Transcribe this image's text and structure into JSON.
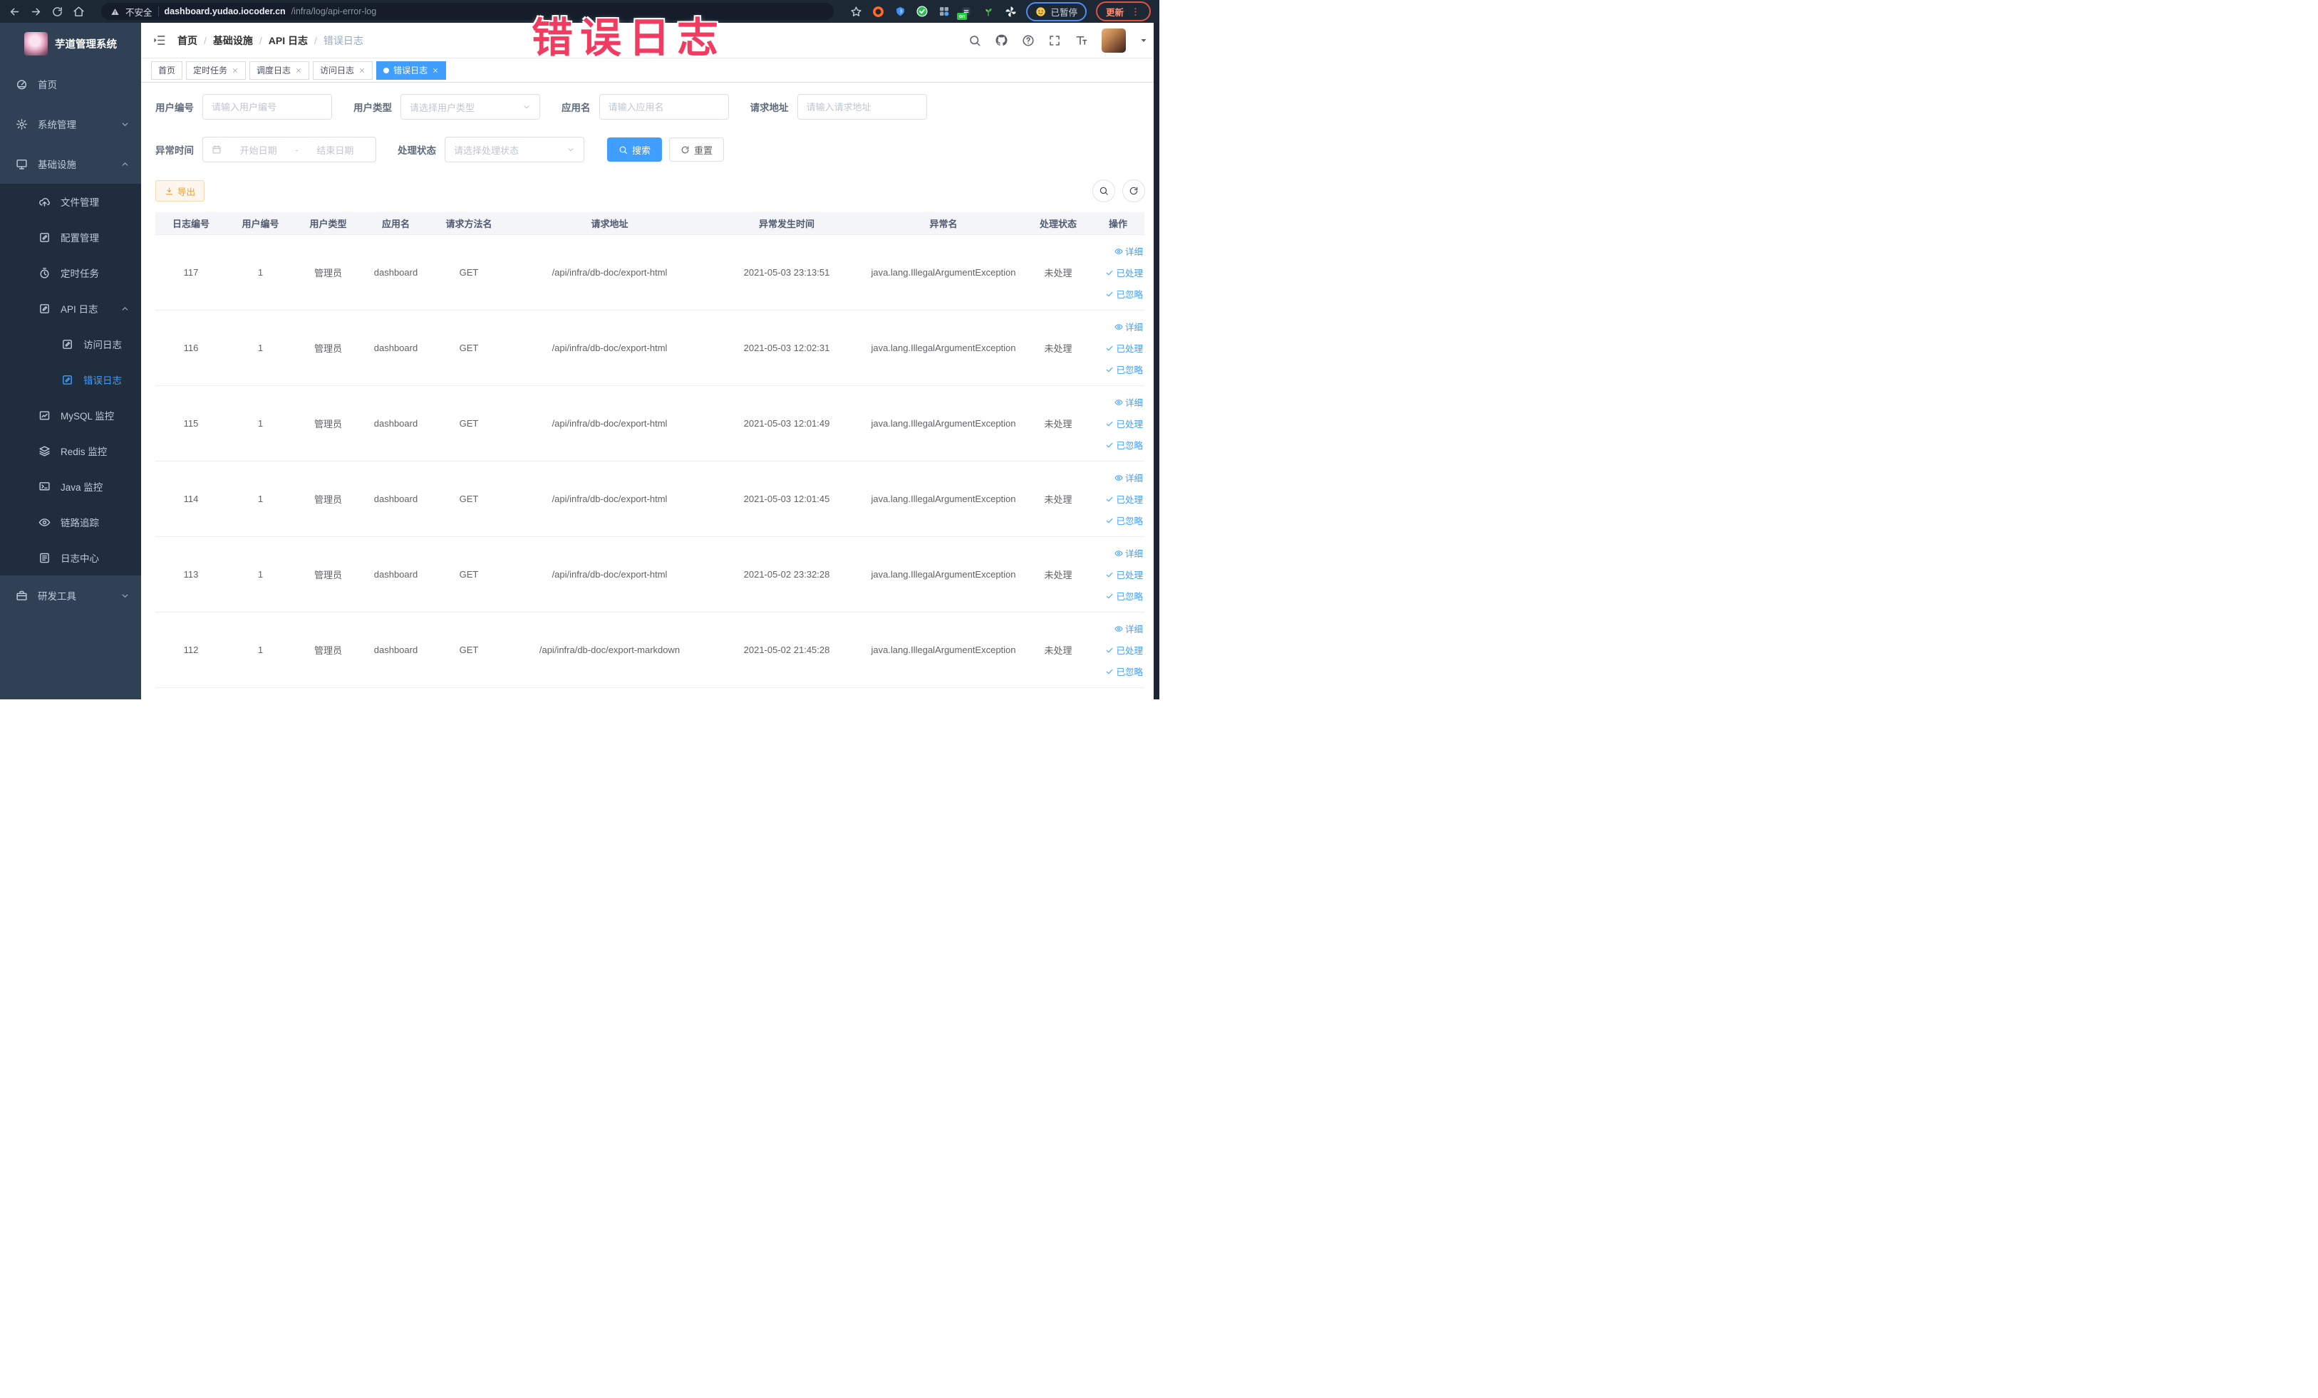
{
  "browser": {
    "security_label": "不安全",
    "url_host": "dashboard.yudao.iocoder.cn",
    "url_path": "/infra/log/api-error-log",
    "extension_badge": "on",
    "paused_label": "已暂停",
    "update_label": "更新"
  },
  "annotation": {
    "text": "错误日志",
    "color": "#f23b60"
  },
  "sidebar": {
    "title": "芋道管理系统",
    "items": [
      {
        "label": "首页",
        "icon": "dashboard-icon",
        "depth": 0
      },
      {
        "label": "系统管理",
        "icon": "gear-icon",
        "depth": 0,
        "chevron": "down"
      },
      {
        "label": "基础设施",
        "icon": "monitor-icon",
        "depth": 0,
        "chevron": "up"
      },
      {
        "label": "文件管理",
        "icon": "upload-icon",
        "depth": 1
      },
      {
        "label": "配置管理",
        "icon": "edit-icon",
        "depth": 1
      },
      {
        "label": "定时任务",
        "icon": "timer-icon",
        "depth": 1
      },
      {
        "label": "API 日志",
        "icon": "edit-icon",
        "depth": 1,
        "chevron": "up"
      },
      {
        "label": "访问日志",
        "icon": "edit-icon",
        "depth": 2
      },
      {
        "label": "错误日志",
        "icon": "edit-icon",
        "depth": 2,
        "active": true
      },
      {
        "label": "MySQL 监控",
        "icon": "chart-icon",
        "depth": 1
      },
      {
        "label": "Redis 监控",
        "icon": "layers-icon",
        "depth": 1
      },
      {
        "label": "Java 监控",
        "icon": "java-icon",
        "depth": 1
      },
      {
        "label": "链路追踪",
        "icon": "eye-icon",
        "depth": 1
      },
      {
        "label": "日志中心",
        "icon": "logcenter-icon",
        "depth": 1
      },
      {
        "label": "研发工具",
        "icon": "tool-icon",
        "depth": 0,
        "chevron": "down"
      }
    ]
  },
  "navbar": {
    "breadcrumb": [
      "首页",
      "基础设施",
      "API 日志",
      "错误日志"
    ]
  },
  "tabs": [
    {
      "label": "首页",
      "closable": false,
      "active": false
    },
    {
      "label": "定时任务",
      "closable": true,
      "active": false
    },
    {
      "label": "调度日志",
      "closable": true,
      "active": false
    },
    {
      "label": "访问日志",
      "closable": true,
      "active": false
    },
    {
      "label": "错误日志",
      "closable": true,
      "active": true
    }
  ],
  "filters": {
    "row1": [
      {
        "label": "用户编号",
        "type": "input",
        "placeholder": "请输入用户编号"
      },
      {
        "label": "用户类型",
        "type": "select",
        "placeholder": "请选择用户类型"
      },
      {
        "label": "应用名",
        "type": "input",
        "placeholder": "请输入应用名"
      },
      {
        "label": "请求地址",
        "type": "input",
        "placeholder": "请输入请求地址"
      }
    ],
    "row2": [
      {
        "label": "异常时间",
        "type": "daterange",
        "start_placeholder": "开始日期",
        "separator": "-",
        "end_placeholder": "结束日期"
      },
      {
        "label": "处理状态",
        "type": "select",
        "placeholder": "请选择处理状态"
      }
    ],
    "search_label": "搜索",
    "reset_label": "重置"
  },
  "toolbar": {
    "export_label": "导出"
  },
  "table": {
    "columns": [
      "日志编号",
      "用户编号",
      "用户类型",
      "应用名",
      "请求方法名",
      "请求地址",
      "异常发生时间",
      "异常名",
      "处理状态",
      "操作"
    ],
    "row_actions": [
      "详细",
      "已处理",
      "已忽略"
    ],
    "rows": [
      {
        "id": "117",
        "user_id": "1",
        "user_type": "管理员",
        "app": "dashboard",
        "method": "GET",
        "url": "/api/infra/db-doc/export-html",
        "time": "2021-05-03 23:13:51",
        "exception": "java.lang.IllegalArgumentException",
        "status": "未处理"
      },
      {
        "id": "116",
        "user_id": "1",
        "user_type": "管理员",
        "app": "dashboard",
        "method": "GET",
        "url": "/api/infra/db-doc/export-html",
        "time": "2021-05-03 12:02:31",
        "exception": "java.lang.IllegalArgumentException",
        "status": "未处理"
      },
      {
        "id": "115",
        "user_id": "1",
        "user_type": "管理员",
        "app": "dashboard",
        "method": "GET",
        "url": "/api/infra/db-doc/export-html",
        "time": "2021-05-03 12:01:49",
        "exception": "java.lang.IllegalArgumentException",
        "status": "未处理"
      },
      {
        "id": "114",
        "user_id": "1",
        "user_type": "管理员",
        "app": "dashboard",
        "method": "GET",
        "url": "/api/infra/db-doc/export-html",
        "time": "2021-05-03 12:01:45",
        "exception": "java.lang.IllegalArgumentException",
        "status": "未处理"
      },
      {
        "id": "113",
        "user_id": "1",
        "user_type": "管理员",
        "app": "dashboard",
        "method": "GET",
        "url": "/api/infra/db-doc/export-html",
        "time": "2021-05-02 23:32:28",
        "exception": "java.lang.IllegalArgumentException",
        "status": "未处理"
      },
      {
        "id": "112",
        "user_id": "1",
        "user_type": "管理员",
        "app": "dashboard",
        "method": "GET",
        "url": "/api/infra/db-doc/export-markdown",
        "time": "2021-05-02 21:45:28",
        "exception": "java.lang.IllegalArgumentException",
        "status": "未处理"
      }
    ]
  }
}
